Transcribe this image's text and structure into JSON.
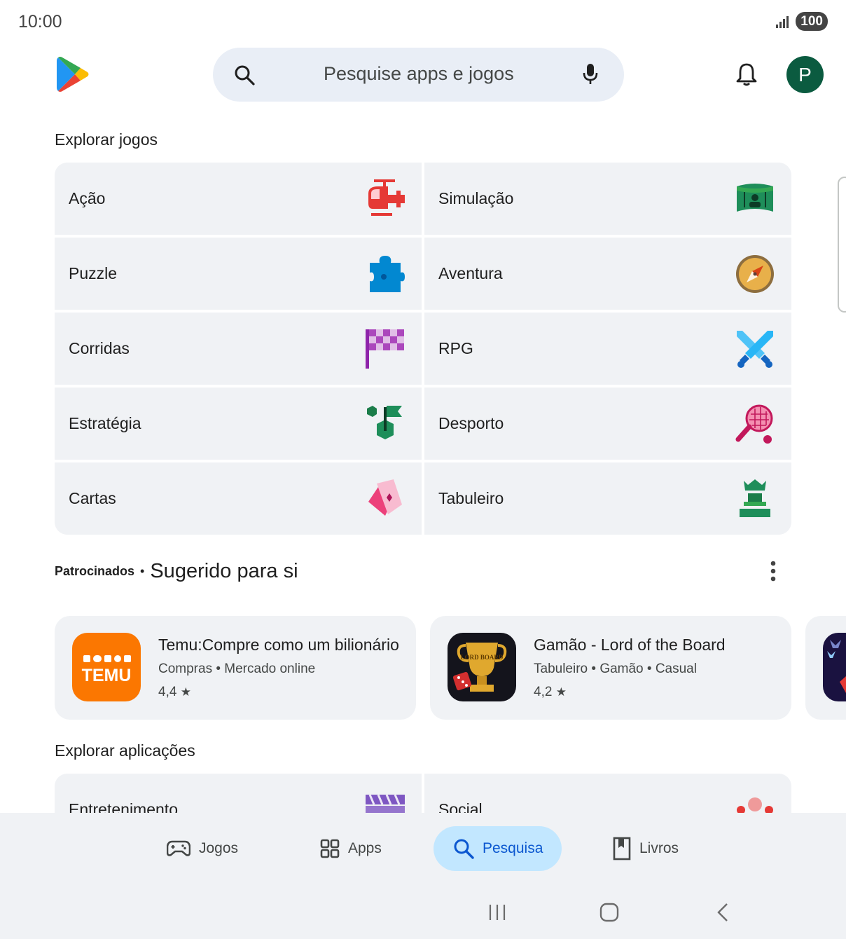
{
  "status_bar": {
    "time": "10:00",
    "battery": "100"
  },
  "search": {
    "placeholder": "Pesquise apps e jogos"
  },
  "avatar_letter": "P",
  "explore_games": {
    "title": "Explorar jogos",
    "categories": [
      {
        "label": "Ação",
        "icon": "helicopter-icon"
      },
      {
        "label": "Simulação",
        "icon": "simulation-icon"
      },
      {
        "label": "Puzzle",
        "icon": "puzzle-piece-icon"
      },
      {
        "label": "Aventura",
        "icon": "compass-icon"
      },
      {
        "label": "Corridas",
        "icon": "checkered-flag-icon"
      },
      {
        "label": "RPG",
        "icon": "crossed-swords-icon"
      },
      {
        "label": "Estratégia",
        "icon": "strategy-icon"
      },
      {
        "label": "Desporto",
        "icon": "racket-icon"
      },
      {
        "label": "Cartas",
        "icon": "cards-icon"
      },
      {
        "label": "Tabuleiro",
        "icon": "chess-piece-icon"
      }
    ]
  },
  "suggested": {
    "sponsored_label": "Patrocinados",
    "separator": "•",
    "title": "Sugerido para si",
    "apps": [
      {
        "name": "Temu:Compre como um bilionário",
        "meta": "Compras  •  Mercado online",
        "rating": "4,4",
        "icon": "temu-logo",
        "icon_text": "TEMU"
      },
      {
        "name": "Gamão - Lord of the Board",
        "meta": "Tabuleiro  •  Gamão  •  Casual",
        "rating": "4,2",
        "icon": "backgammon-trophy-logo",
        "icon_text": "LORD BOARD"
      }
    ]
  },
  "explore_apps": {
    "title": "Explorar aplicações",
    "categories": [
      {
        "label": "Entretenimento",
        "icon": "clapperboard-icon"
      },
      {
        "label": "Social",
        "icon": "people-icon"
      }
    ]
  },
  "bottom_nav": {
    "items": [
      {
        "label": "Jogos",
        "icon": "gamepad-icon"
      },
      {
        "label": "Apps",
        "icon": "apps-grid-icon"
      },
      {
        "label": "Pesquisa",
        "icon": "search-icon",
        "active": true
      },
      {
        "label": "Livros",
        "icon": "book-icon"
      }
    ]
  },
  "colors": {
    "accent": "#0b57d0",
    "active_pill": "#c2e7ff",
    "avatar": "#0b5b40",
    "tile_bg": "#f0f2f5"
  }
}
